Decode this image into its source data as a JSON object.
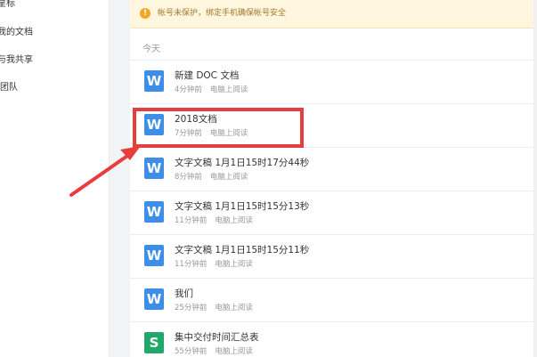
{
  "sidebar": {
    "items": [
      {
        "label": "星标"
      },
      {
        "label": "我的文档"
      },
      {
        "label": "与我共享"
      },
      {
        "label": "团队"
      }
    ]
  },
  "notice": {
    "icon": "warning-icon",
    "text": "帐号未保护，绑定手机确保帐号安全"
  },
  "list": {
    "group_label": "今天",
    "items": [
      {
        "name": "新建 DOC 文档",
        "time": "4分钟前",
        "source": "电脑上阅读",
        "icon_letter": "W",
        "type": "doc"
      },
      {
        "name": "2018文档",
        "time": "7分钟前",
        "source": "电脑上阅读",
        "icon_letter": "W",
        "type": "doc"
      },
      {
        "name": "文字文稿 1月1日15时17分44秒",
        "time": "8分钟前",
        "source": "电脑上阅读",
        "icon_letter": "W",
        "type": "doc"
      },
      {
        "name": "文字文稿 1月1日15时15分13秒",
        "time": "11分钟前",
        "source": "电脑上阅读",
        "icon_letter": "W",
        "type": "doc"
      },
      {
        "name": "文字文稿 1月1日15时15分11秒",
        "time": "11分钟前",
        "source": "电脑上阅读",
        "icon_letter": "W",
        "type": "doc"
      },
      {
        "name": "我们",
        "time": "25分钟前",
        "source": "电脑上阅读",
        "icon_letter": "W",
        "type": "doc"
      },
      {
        "name": "集中交付时间汇总表",
        "time": "55分钟前",
        "source": "电脑上阅读",
        "icon_letter": "S",
        "type": "sheet"
      }
    ]
  },
  "colors": {
    "doc_icon": "#3d8ee8",
    "sheet_icon": "#22a86a",
    "annotation": "#e83d3d",
    "notice_bg": "#fff6e0"
  }
}
